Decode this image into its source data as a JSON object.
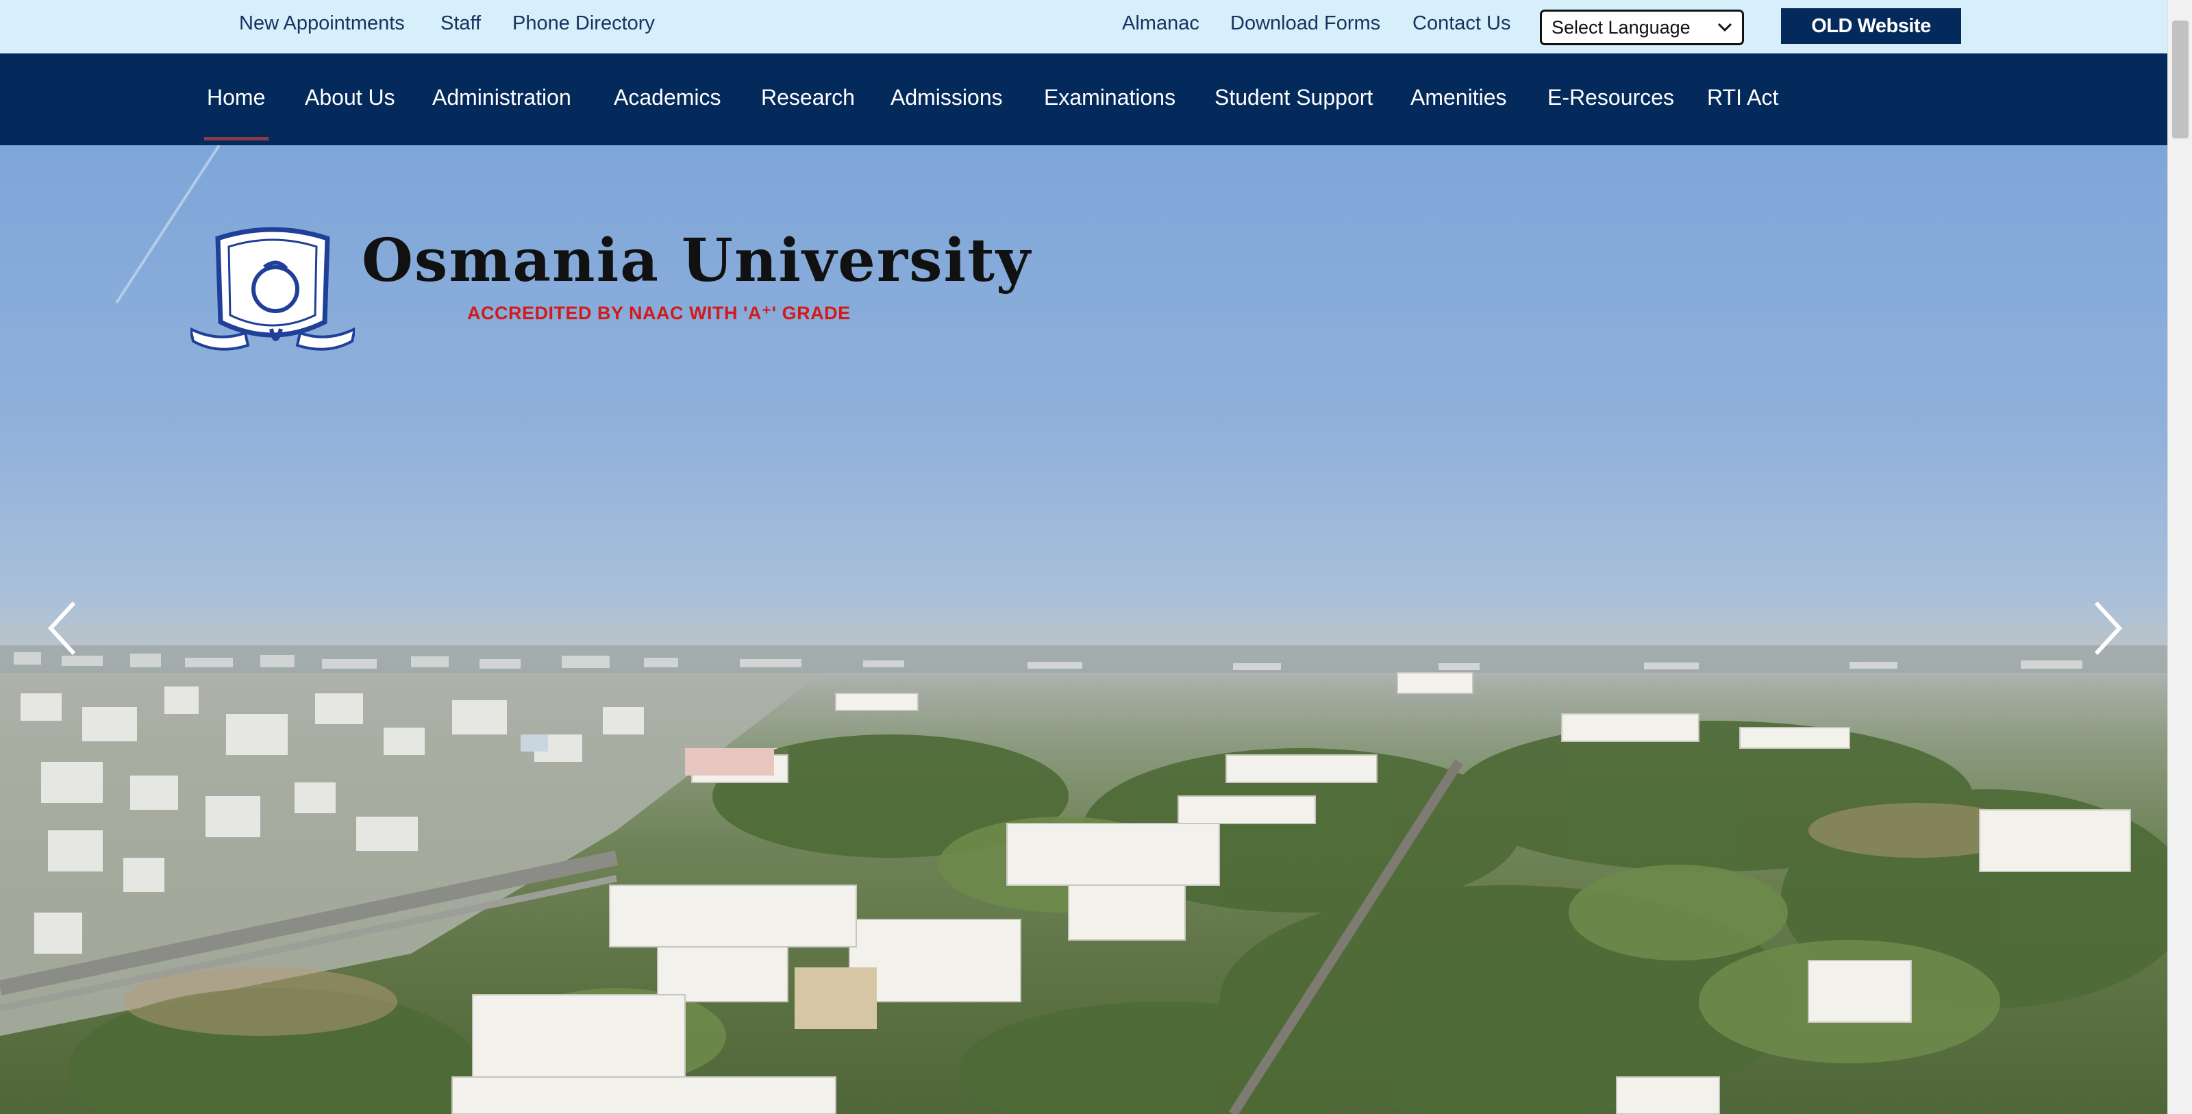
{
  "utility_bar": {
    "left_links": [
      "New Appointments",
      "Staff",
      "Phone Directory"
    ],
    "right_links": [
      "Almanac",
      "Download Forms",
      "Contact Us"
    ],
    "language_select": {
      "selected": "Select Language"
    },
    "old_website_label": "OLD Website"
  },
  "nav": {
    "items": [
      "Home",
      "About Us",
      "Administration",
      "Academics",
      "Research",
      "Admissions",
      "Examinations",
      "Student Support",
      "Amenities",
      "E-Resources",
      "RTI Act"
    ],
    "active": "Home"
  },
  "hero": {
    "title": "Osmania University",
    "subtitle": "ACCREDITED BY NAAC WITH 'A⁺' GRADE",
    "emblem_icon": "university-emblem-icon",
    "prev_icon": "chevron-left-icon",
    "next_icon": "chevron-right-icon"
  },
  "colors": {
    "utility_bg": "#d7effb",
    "nav_bg": "#042a5c",
    "link_text": "#18335e",
    "accent_red": "#d21a1a"
  }
}
